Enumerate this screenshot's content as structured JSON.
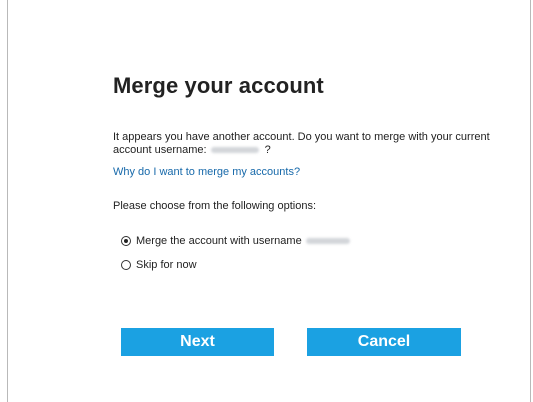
{
  "dialog": {
    "title": "Merge your account",
    "description_part1": "It appears you have another account. Do you want to merge with your current account username:",
    "description_suffix": "?",
    "help_link": "Why do I want to merge my accounts?",
    "choose_prompt": "Please choose from the following options:",
    "options": [
      {
        "label": "Merge the account with username",
        "selected": true
      },
      {
        "label": "Skip for now",
        "selected": false
      }
    ],
    "buttons": {
      "next": "Next",
      "cancel": "Cancel"
    }
  },
  "colors": {
    "button_bg": "#1ba1e2",
    "link": "#1769aa"
  }
}
